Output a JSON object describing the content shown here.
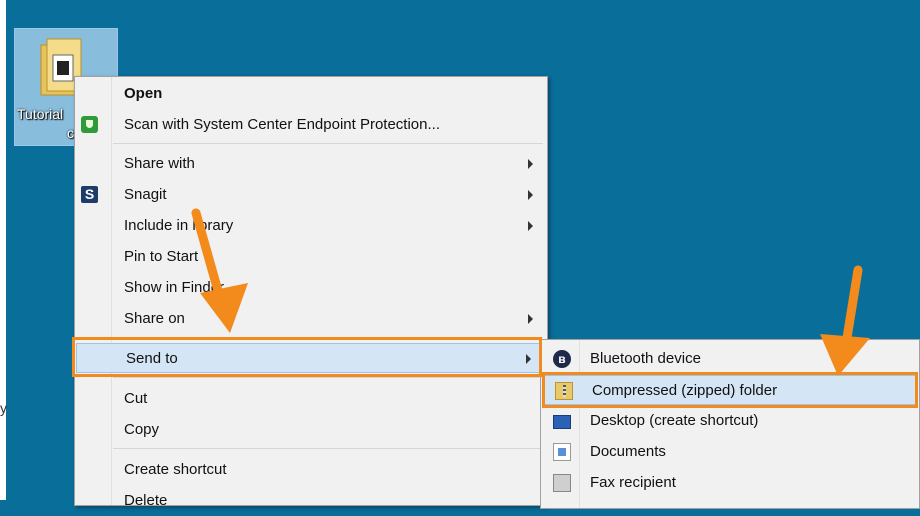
{
  "desktop": {
    "icon_label_line1": "Tutorial",
    "icon_label_line2": "ct",
    "left_edge_text": "y"
  },
  "context_menu": {
    "items": [
      {
        "label": "Open",
        "bold": true
      },
      {
        "label": "Scan with System Center Endpoint Protection...",
        "icon": "shield-icon"
      },
      {
        "label": "Share with",
        "submenu": true
      },
      {
        "label": "Snagit",
        "icon": "snagit-icon",
        "submenu": true
      },
      {
        "label": "Include in library",
        "submenu": true
      },
      {
        "label": "Pin to Start"
      },
      {
        "label": "Show in Finder"
      },
      {
        "label": "Share on",
        "submenu": true
      },
      {
        "label": "Send to",
        "submenu": true,
        "highlighted": true
      },
      {
        "label": "Cut"
      },
      {
        "label": "Copy"
      },
      {
        "label": "Create shortcut"
      },
      {
        "label": "Delete"
      }
    ],
    "snagit_glyph": "S"
  },
  "send_to_submenu": {
    "items": [
      {
        "label": "Bluetooth device",
        "icon": "bluetooth-icon"
      },
      {
        "label": "Compressed (zipped) folder",
        "icon": "zip-folder-icon",
        "highlighted": true
      },
      {
        "label": "Desktop (create shortcut)",
        "icon": "desktop-icon"
      },
      {
        "label": "Documents",
        "icon": "documents-icon"
      },
      {
        "label": "Fax recipient",
        "icon": "fax-icon"
      }
    ],
    "bluetooth_glyph": "ʙ"
  },
  "annotation_color": "#f28a1c"
}
